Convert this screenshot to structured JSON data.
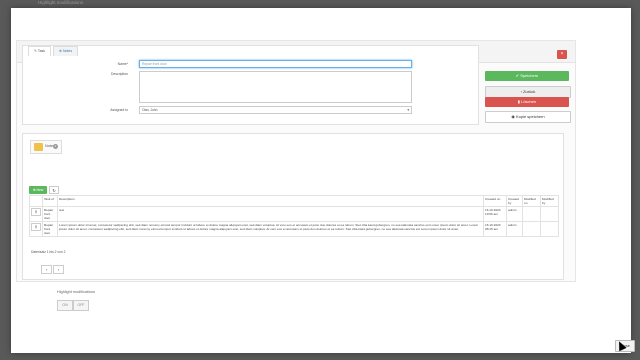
{
  "top": {
    "cut_text": "Highlight modifications"
  },
  "panel": {
    "type": "Task",
    "title": "Repair front door"
  },
  "tabs": [
    "Task",
    "Notes"
  ],
  "form": {
    "name_label": "Name*",
    "name_placeholder": "Repair front door",
    "description_label": "Description",
    "assigned_label": "Assigned to",
    "assigned_value": "Olav, John"
  },
  "actions": {
    "save": "Speichern",
    "back": "Zurück",
    "delete": "Löschen",
    "copy": "Kopie speichern"
  },
  "notes": {
    "tab_label": "Notes",
    "count": "2",
    "new": "New"
  },
  "table": {
    "headers": [
      "",
      "Task of",
      "Description",
      "Created on",
      "Created by",
      "Modified on",
      "Modified by"
    ],
    "rows": [
      [
        "",
        "Repair front door",
        "test",
        "16.10.2020 10:06 am",
        "admin",
        "",
        ""
      ],
      [
        "",
        "Repair front door",
        "Lorem ipsum dolor sit amet, consetetur sadipscing elitr, sed diam nonumy eirmod tempor invidunt ut labore et dolore magna aliquyam erat, sed diam voluptua. At vero eos et accusam et justo duo dolores et ea rebum. Stet clita kasd gubergren, no sea takimata sanctus est Lorem ipsum dolor sit amet. Lorem ipsum dolor sit amet, consetetur sadipscing elitr, sed diam nonumy eirmod tempor invidunt ut labore et dolore magna aliquyam erat, sed diam voluptua. At vero eos et accusam et justo duo dolores et ea rebum. Stet clita kasd gubergren, no sea takimata sanctus est Lorem ipsum dolor sit amet.",
        "16.10.2020 08:15 am",
        "admin",
        "",
        ""
      ]
    ],
    "footer": "Datensatz 1 bis 2 von 2"
  },
  "highlight": {
    "label": "Highlight modifications",
    "on": "ON",
    "off": "OFF"
  },
  "close_label": "Close",
  "icons": {
    "search": "search-icon",
    "refresh": "refresh-icon",
    "plus": "plus-icon"
  }
}
